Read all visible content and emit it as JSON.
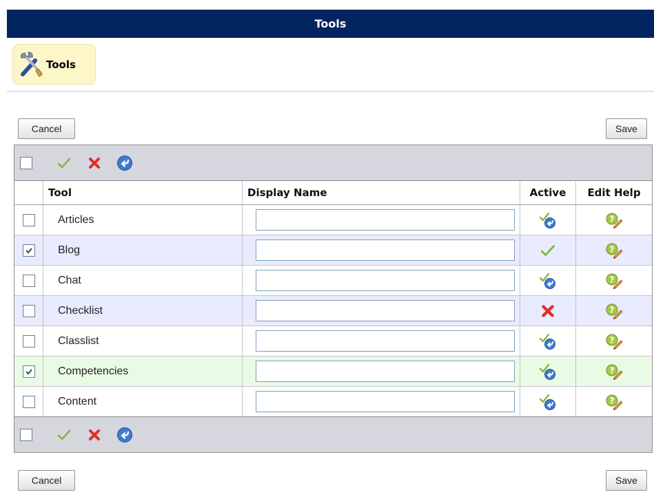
{
  "page": {
    "title": "Tools"
  },
  "badge": {
    "label": "Tools",
    "icon": "tools-icon"
  },
  "buttons": {
    "cancel": "Cancel",
    "save": "Save"
  },
  "toolbar": {
    "icons": [
      "select-all-checkbox",
      "activate-icon",
      "deactivate-icon",
      "restore-default-icon"
    ]
  },
  "table": {
    "headers": {
      "tool": "Tool",
      "display_name": "Display Name",
      "active": "Active",
      "edit_help": "Edit Help"
    },
    "rows": [
      {
        "tool": "Articles",
        "checked": false,
        "display_name": "",
        "active_status": "default",
        "bg": "#ffffff"
      },
      {
        "tool": "Blog",
        "checked": true,
        "display_name": "",
        "active_status": "active",
        "bg": "#e9ebff"
      },
      {
        "tool": "Chat",
        "checked": false,
        "display_name": "",
        "active_status": "default",
        "bg": "#ffffff"
      },
      {
        "tool": "Checklist",
        "checked": false,
        "display_name": "",
        "active_status": "inactive",
        "bg": "#e9ebff"
      },
      {
        "tool": "Classlist",
        "checked": false,
        "display_name": "",
        "active_status": "default",
        "bg": "#ffffff"
      },
      {
        "tool": "Competencies",
        "checked": true,
        "display_name": "",
        "active_status": "default",
        "bg": "#e9fbe4"
      },
      {
        "tool": "Content",
        "checked": false,
        "display_name": "",
        "active_status": "default",
        "bg": "#ffffff"
      }
    ]
  },
  "colors": {
    "title_bar": "#022561",
    "toolbar": "#d6d6de",
    "badge_bg": "#fdf6c9"
  }
}
